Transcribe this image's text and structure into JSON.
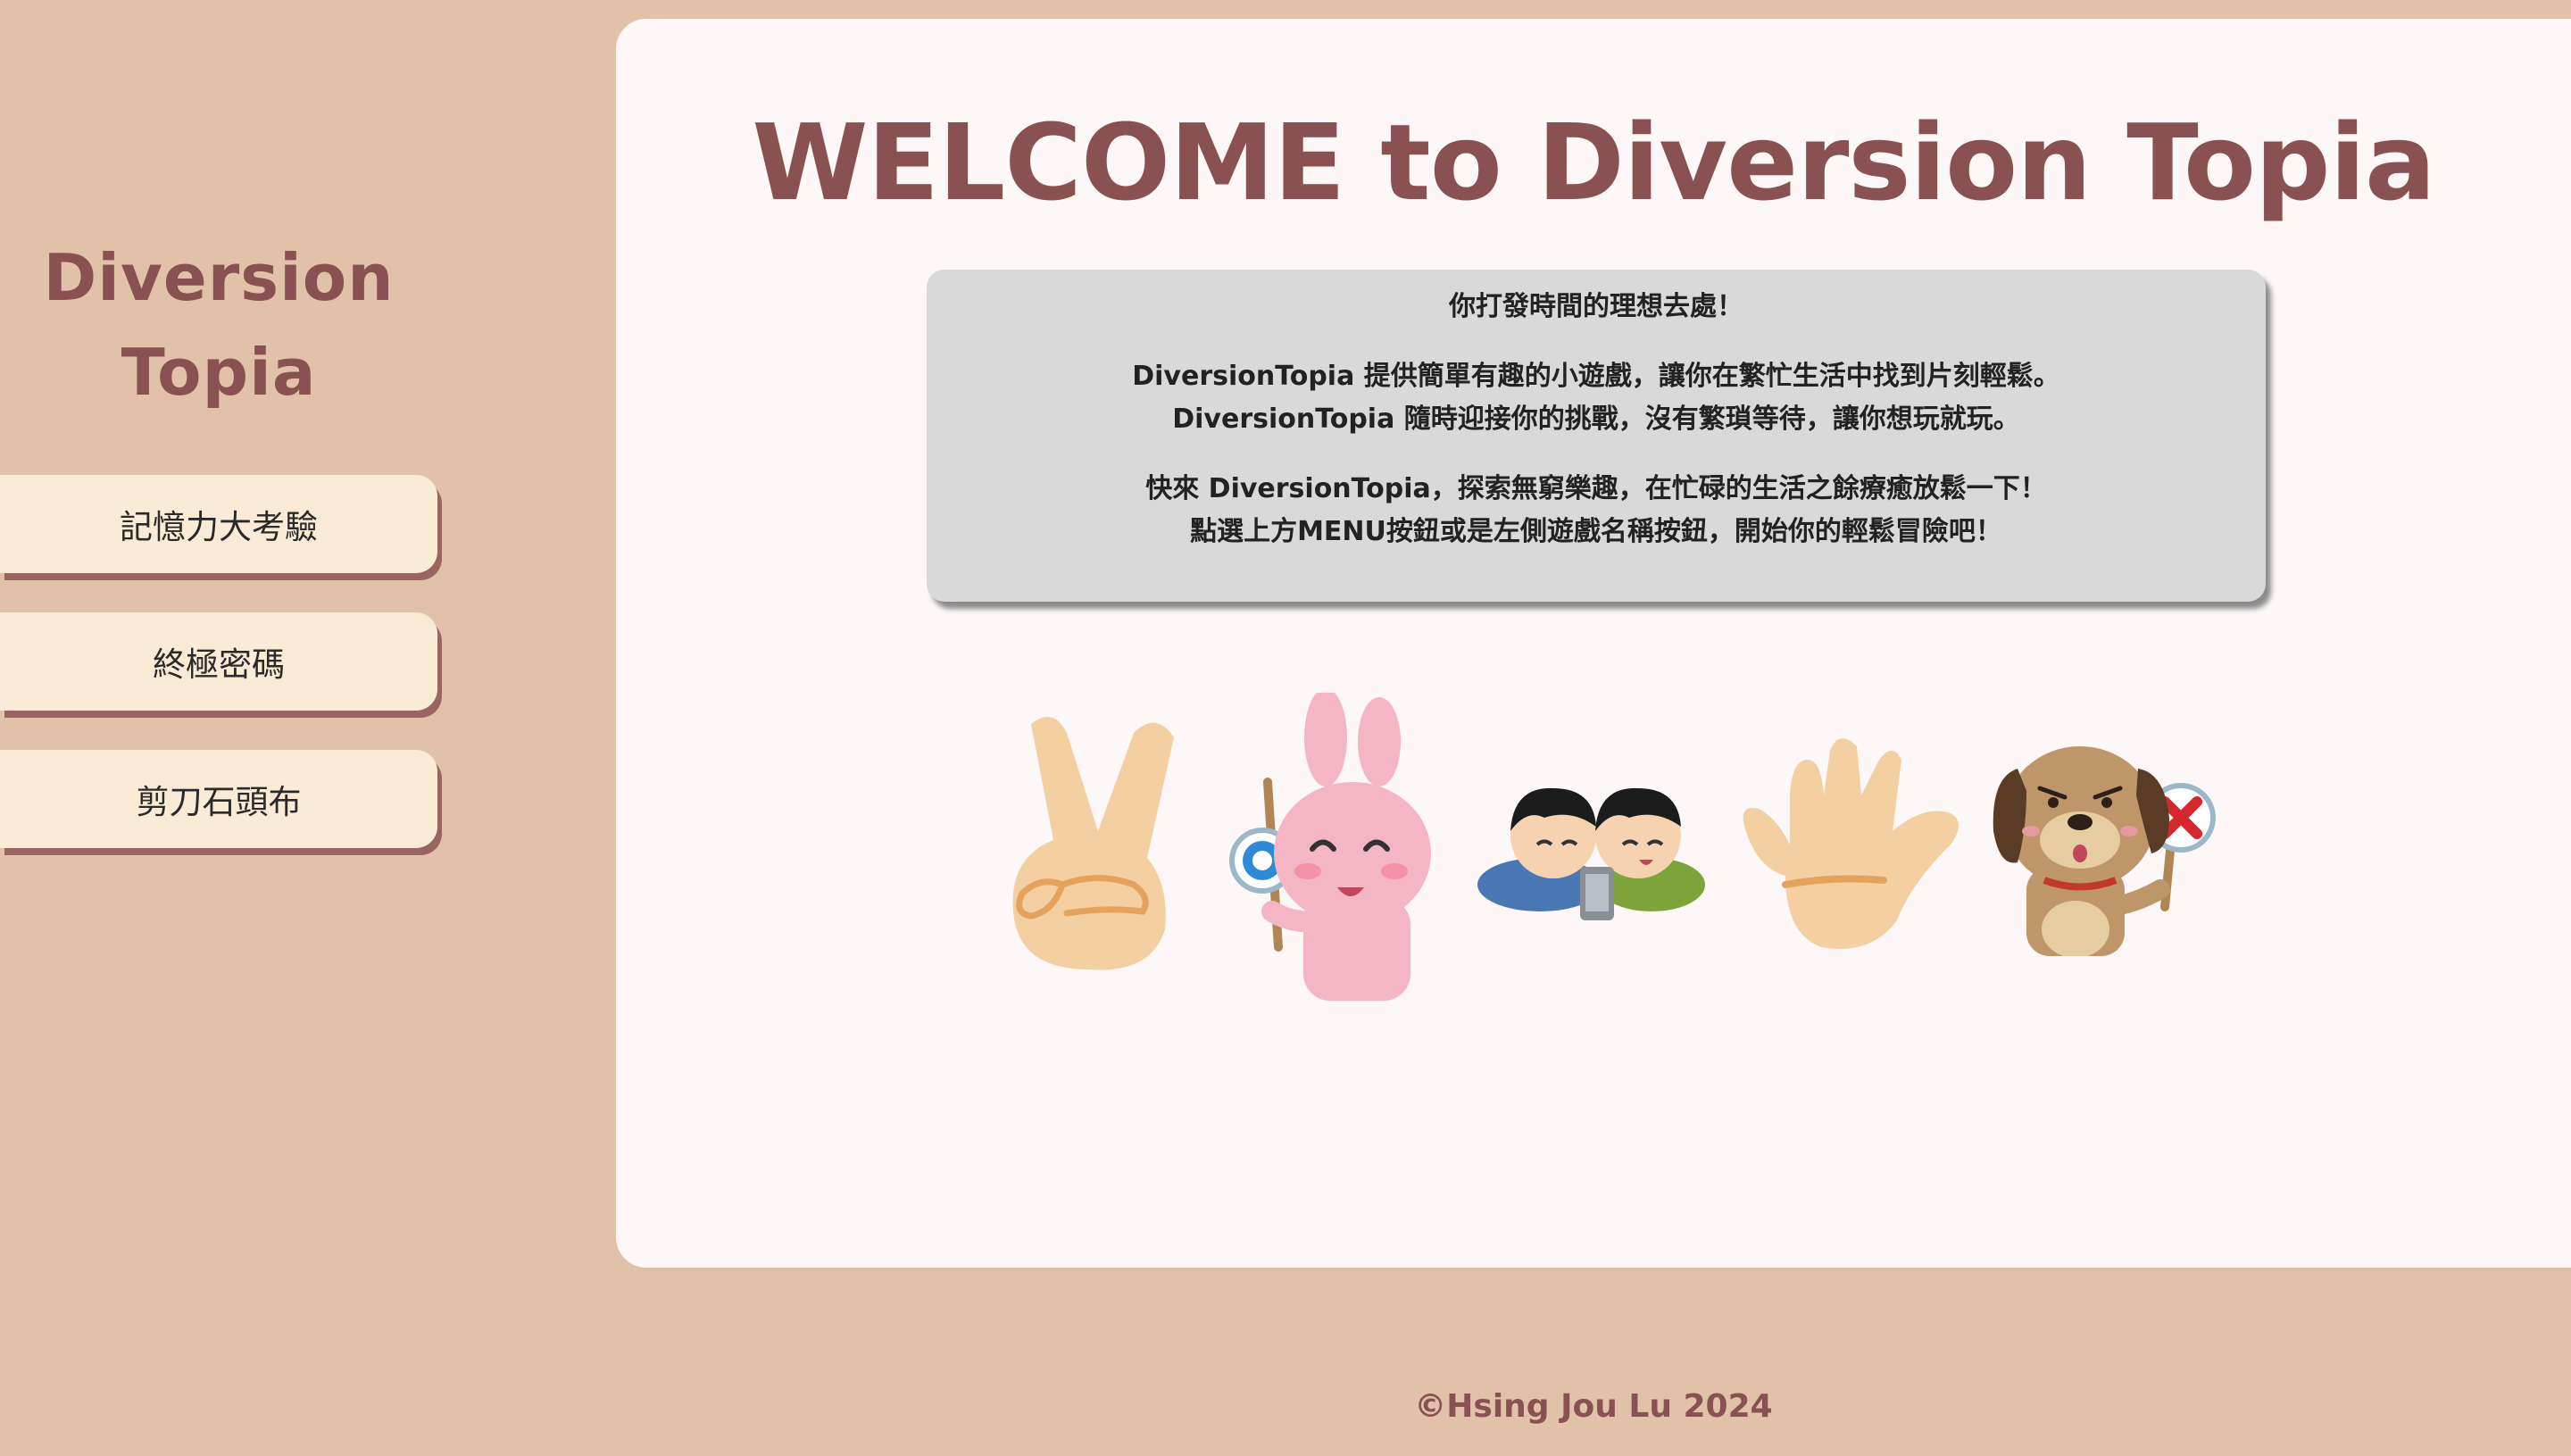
{
  "sidebar": {
    "logo_line1": "Diversion",
    "logo_line2": "Topia",
    "items": [
      {
        "label": "記憶力大考驗"
      },
      {
        "label": "終極密碼"
      },
      {
        "label": "剪刀石頭布"
      }
    ]
  },
  "main": {
    "title": "WELCOME to Diversion Topia",
    "tagline": "你打發時間的理想去處！",
    "para1_line1": "DiversionTopia 提供簡單有趣的小遊戲，讓你在繁忙生活中找到片刻輕鬆。",
    "para1_line2": "DiversionTopia 隨時迎接你的挑戰，沒有繁瑣等待，讓你想玩就玩。",
    "para2_line1": "快來 DiversionTopia，探索無窮樂趣，在忙碌的生活之餘療癒放鬆一下！",
    "para2_line2": "點選上方MENU按鈕或是左側遊戲名稱按鈕，開始你的輕鬆冒險吧！",
    "illustrations": [
      {
        "icon": "peace-sign-hand-icon"
      },
      {
        "icon": "pink-rabbit-correct-sign-icon"
      },
      {
        "icon": "two-boys-smartphone-icon"
      },
      {
        "icon": "open-palm-hand-icon"
      },
      {
        "icon": "dog-wrong-sign-icon"
      }
    ]
  },
  "footer": {
    "copyright": "©Hsing Jou Lu 2024"
  },
  "colors": {
    "background": "#e1c2a9",
    "accent": "#8a5152",
    "button_bg": "#faebd7",
    "panel_bg": "#fdf8f7",
    "info_bg": "#d9d9d9"
  }
}
